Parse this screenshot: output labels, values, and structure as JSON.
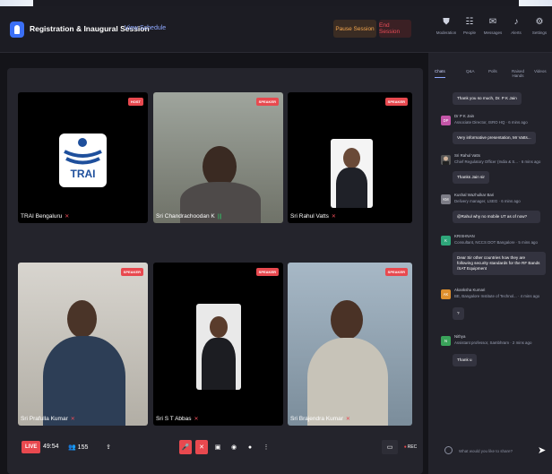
{
  "header": {
    "title": "Registration & Inaugural Session",
    "view_schedule": "View Schedule",
    "pause_label": "Pause Session",
    "end_label": "End Session",
    "icons": [
      {
        "label": "Moderation",
        "glyph": "⛊"
      },
      {
        "label": "People",
        "glyph": "☷"
      },
      {
        "label": "Messages",
        "glyph": "✉"
      },
      {
        "label": "Alerts",
        "glyph": "♪"
      },
      {
        "label": "Settings",
        "glyph": "⚙"
      }
    ]
  },
  "tiles": [
    {
      "name": "TRAI Bengaluru",
      "badge": "HOST",
      "logo_text": "TRAI"
    },
    {
      "name": "Sri Chandrachoodan K",
      "badge": "SPEAKER"
    },
    {
      "name": "Sri Rahul Vatts",
      "badge": "SPEAKER"
    },
    {
      "name": "Sri Prafulla Kumar",
      "badge": "SPEAKER"
    },
    {
      "name": "Sri S T Abbas",
      "badge": "SPEAKER"
    },
    {
      "name": "Sri Brajendra Kumar",
      "badge": "SPEAKER"
    }
  ],
  "controls": {
    "live": "LIVE",
    "timer": "49:54",
    "viewers": "155",
    "rec": "REC"
  },
  "chat": {
    "tabs": [
      "Chats",
      "Q&A",
      "Polls",
      "Raised Hands",
      "Videos"
    ],
    "messages": [
      {
        "text": "Thank you so much, Dr. P K Jain"
      },
      {
        "initials": "DP",
        "name": "Dr P K Jain",
        "sub": "Associate Director, ISRO HQ · 6 mins ago"
      },
      {
        "text": "Very informative presentation, Mr Vatts..."
      },
      {
        "initials": "",
        "name": "Sri Rahul Vatts",
        "sub": "Chief Regulatory Officer (India & S... · 6 mins ago"
      },
      {
        "text": "Thanks Jain sir"
      },
      {
        "initials": "KM",
        "name": "Kushal Wazhulkar Bari",
        "sub": "Delivery manager, LSEG · 6 mins ago"
      },
      {
        "text": "@Rahul why no mobile UT as of now?"
      },
      {
        "initials": "K",
        "name": "KRISHNAN",
        "sub": "Consultant, NCCS DOT Bangalore · 5 mins ago"
      },
      {
        "text": "Dear Sir other countries how they are following security standards for the RF Bands /SAT Equipment"
      },
      {
        "initials": "AK",
        "name": "Akanksha Kumari",
        "sub": "BE, Bangalore Institute of Technol... · 4 mins ago"
      },
      {
        "text": "?"
      },
      {
        "initials": "N",
        "name": "Nithya",
        "sub": "Assistant professor, Sambhram · 2 mins ago"
      },
      {
        "text": "Thank u"
      }
    ],
    "input_placeholder": "What would you like to share?"
  },
  "colors": {
    "accent": "#3b6ff5",
    "live": "#e8494f",
    "pause": "#f3a64e",
    "end": "#e84b57"
  }
}
